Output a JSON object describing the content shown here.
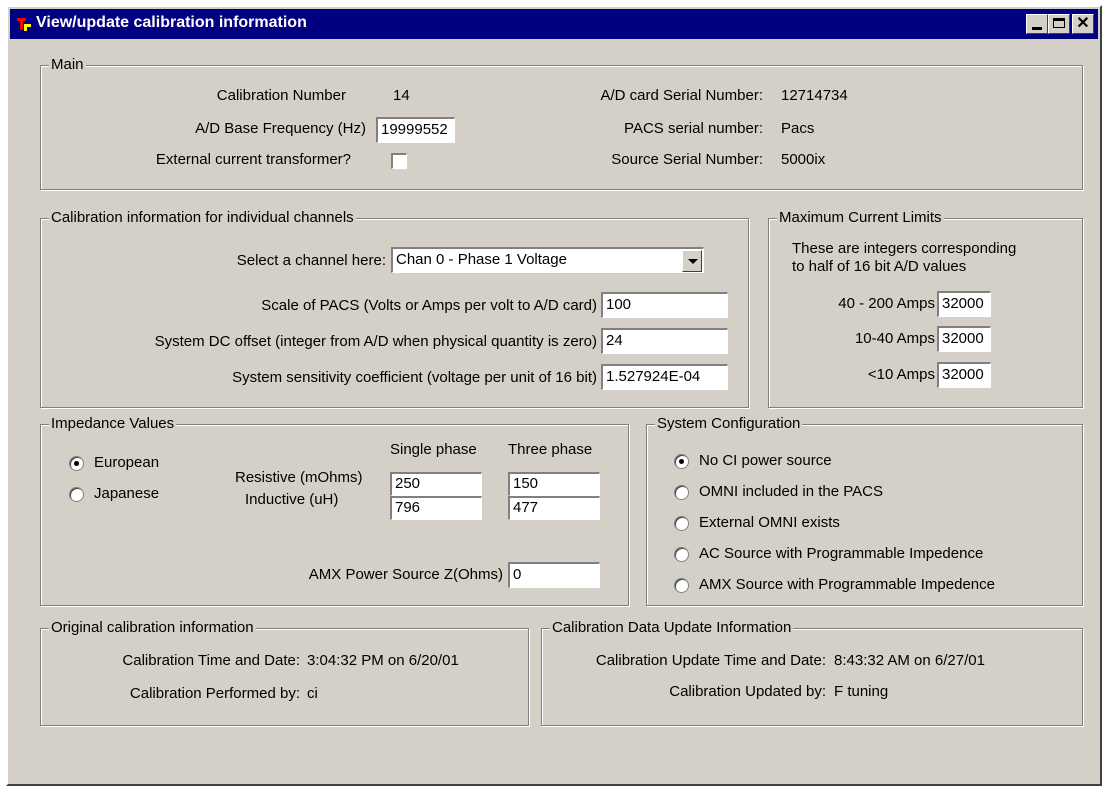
{
  "window": {
    "title": "View/update calibration information"
  },
  "main": {
    "legend": "Main",
    "calibration_number_label": "Calibration Number",
    "calibration_number": "14",
    "ad_base_freq_label": "A/D Base Frequency (Hz)",
    "ad_base_freq": "19999552",
    "ext_ct_label": "External current transformer?",
    "ext_ct_checked": false,
    "ad_serial_label": "A/D card  Serial Number:",
    "ad_serial": "12714734",
    "pacs_serial_label": "PACS serial number:",
    "pacs_serial": "Pacs",
    "source_serial_label": "Source Serial Number:",
    "source_serial": "5000ix"
  },
  "channels": {
    "legend": "Calibration information for individual channels",
    "select_label": "Select a channel here:",
    "selected_channel": "Chan 0 - Phase 1 Voltage",
    "scale_label": "Scale of PACS (Volts or Amps per volt to A/D card)",
    "scale": "100",
    "dc_offset_label": "System DC offset (integer from A/D when physical quantity is zero)",
    "dc_offset": "24",
    "sensitivity_label": "System sensitivity coefficient (voltage per unit of 16 bit)",
    "sensitivity": "1.527924E-04"
  },
  "limits": {
    "legend": "Maximum Current Limits",
    "desc_line1": "These are integers corresponding",
    "desc_line2": "to half of 16 bit A/D values",
    "rows": [
      {
        "label": "40 - 200 Amps",
        "value": "32000"
      },
      {
        "label": "10-40 Amps",
        "value": "32000"
      },
      {
        "label": "<10 Amps",
        "value": "32000"
      }
    ]
  },
  "impedance": {
    "legend": "Impedance Values",
    "radio_european": "European",
    "radio_japanese": "Japanese",
    "selected": "European",
    "col_single": "Single phase",
    "col_three": "Three phase",
    "resistive_label": "Resistive (mOhms)",
    "inductive_label": "Inductive (uH)",
    "resistive_single": "250",
    "resistive_three": "150",
    "inductive_single": "796",
    "inductive_three": "477",
    "amx_label": "AMX Power Source Z(Ohms)",
    "amx_value": "0"
  },
  "sysconfig": {
    "legend": "System Configuration",
    "options": [
      "No CI power source",
      "OMNI included in the PACS",
      "External OMNI exists",
      "AC Source with Programmable Impedence",
      "AMX Source with Programmable Impedence"
    ],
    "selected_index": 0
  },
  "original": {
    "legend": "Original calibration information",
    "time_label": "Calibration Time and Date:",
    "time_value": "3:04:32 PM on 6/20/01",
    "by_label": "Calibration Performed by:",
    "by_value": "ci"
  },
  "update": {
    "legend": "Calibration Data Update Information",
    "time_label": "Calibration Update Time and Date:",
    "time_value": "8:43:32 AM on 6/27/01",
    "by_label": "Calibration Updated by:",
    "by_value": "F tuning"
  }
}
